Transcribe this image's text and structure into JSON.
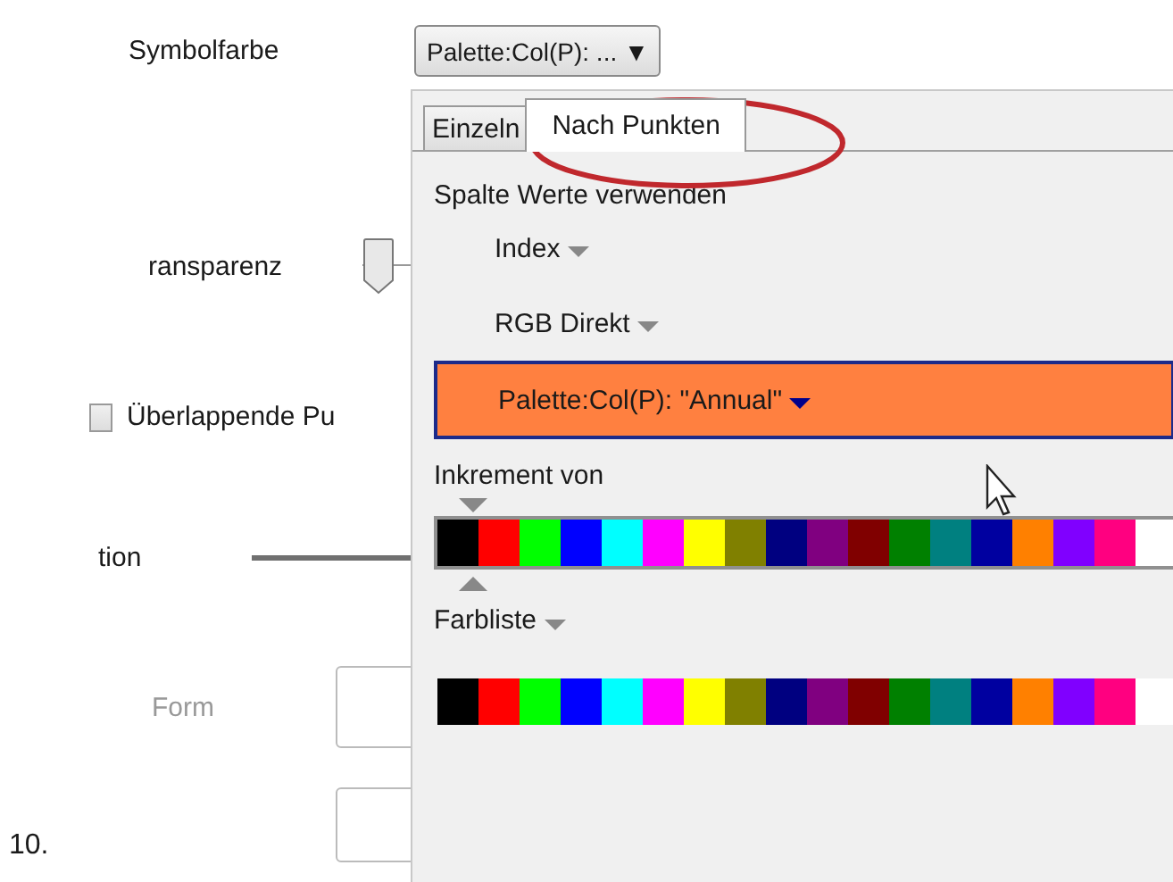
{
  "settings": {
    "symbol_color_label": "Symbolfarbe",
    "symbol_color_button": "Palette:Col(P): ... ▼",
    "transparency_label": "ransparenz",
    "transparency_slider": {
      "level": 0
    },
    "overlap_checkbox": {
      "label": "Überlappende Pu",
      "checked": false
    },
    "section_label": "tion",
    "form_label": "Form",
    "list_number": "10."
  },
  "popup": {
    "tabs": [
      {
        "label": "Einzeln",
        "selected": false
      },
      {
        "label": "Nach Punkten",
        "selected": true
      }
    ],
    "column_values_label": "Spalte Werte verwenden",
    "options": [
      {
        "label": "Index",
        "selected": false
      },
      {
        "label": "RGB Direkt",
        "selected": false
      },
      {
        "label": "Palette:Col(P): \"Annual\"",
        "selected": true
      }
    ],
    "increment_label": "Inkrement von",
    "increment_colors": [
      {
        "color": "#000000"
      },
      {
        "color": "#ff0000"
      },
      {
        "color": "#00ff00"
      },
      {
        "color": "#0000ff"
      },
      {
        "color": "#00ffff"
      },
      {
        "color": "#ff00ff"
      },
      {
        "color": "#ffff00"
      },
      {
        "color": "#808000"
      },
      {
        "color": "#000080"
      },
      {
        "color": "#800080"
      },
      {
        "color": "#800000"
      },
      {
        "color": "#008000"
      },
      {
        "color": "#008080"
      },
      {
        "color": "#0000a0"
      },
      {
        "color": "#ff8000"
      },
      {
        "color": "#8000ff"
      },
      {
        "color": "#ff0080"
      },
      {
        "color": "#ffffff"
      }
    ],
    "color_list_label": "Farbliste",
    "color_list": [
      {
        "color": "#000000"
      },
      {
        "color": "#ff0000"
      },
      {
        "color": "#00ff00"
      },
      {
        "color": "#0000ff"
      },
      {
        "color": "#00ffff"
      },
      {
        "color": "#ff00ff"
      },
      {
        "color": "#ffff00"
      },
      {
        "color": "#808000"
      },
      {
        "color": "#000080"
      },
      {
        "color": "#800080"
      },
      {
        "color": "#800000"
      },
      {
        "color": "#008000"
      },
      {
        "color": "#008080"
      },
      {
        "color": "#0000a0"
      },
      {
        "color": "#ff8000"
      },
      {
        "color": "#8000ff"
      },
      {
        "color": "#ff0080"
      },
      {
        "color": "#ffffff"
      }
    ]
  }
}
